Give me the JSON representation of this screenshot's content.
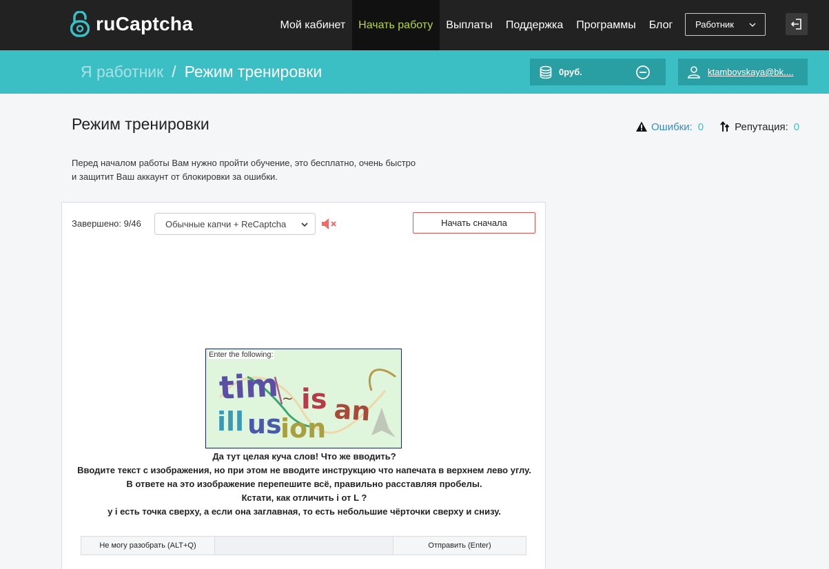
{
  "brand": {
    "name": "ruCaptcha"
  },
  "nav": {
    "items": [
      {
        "label": "Мой кабинет",
        "active": false
      },
      {
        "label": "Начать работу",
        "active": true
      },
      {
        "label": "Выплаты",
        "active": false
      },
      {
        "label": "Поддержка",
        "active": false
      },
      {
        "label": "Программы",
        "active": false
      },
      {
        "label": "Блог",
        "active": false
      }
    ],
    "role": "Работник"
  },
  "breadcrumb": {
    "parent": "Я работник",
    "separator": "/",
    "current": "Режим тренировки"
  },
  "balance": {
    "amount": "0руб."
  },
  "account": {
    "email": "ktambovskaya@bk...."
  },
  "page": {
    "title": "Режим тренировки",
    "intro": "Перед началом работы Вам нужно пройти обучение, это бесплатно, очень быстро и защитит Ваш аккаунт от блокировки за ошибки.",
    "errors_label": "Ошибки:",
    "errors_value": "0",
    "reputation_label": "Репутация:",
    "reputation_value": "0"
  },
  "trainer": {
    "completed": "Завершено: 9/46",
    "mode": "Обычные капчи + ReCaptcha",
    "restart_label": "Начать сначала",
    "captcha_label": "Enter the following:",
    "hints": [
      "Да тут целая куча слов! Что же вводить?",
      "Вводите текст с изображения, но при этом не вводите инструкцию что напечата в верхнем лево углу.",
      "В ответе на это изображение перепешите всё, правильно расставляя пробелы.",
      "Кстати, как отличить i от L ?",
      "у i есть точка сверху, а если она заглавная, то есть небольшие чёрточки сверху и снизу."
    ],
    "cant_read_label": "Не могу разобрать (ALT+Q)",
    "answer_value": "",
    "submit_label": "Отправить (Enter)"
  },
  "colors": {
    "topbar": "#222222",
    "teal": "#3bbfc4",
    "teal_dark": "#2a9fa3",
    "active_nav": "#b6d63a",
    "danger": "#d9534f"
  },
  "icons": [
    "padlock-logo-icon",
    "chevron-down-icon",
    "logout-icon",
    "coins-icon",
    "minus-circle-icon",
    "user-icon",
    "warning-icon",
    "reputation-arrows-icon",
    "mute-icon"
  ]
}
